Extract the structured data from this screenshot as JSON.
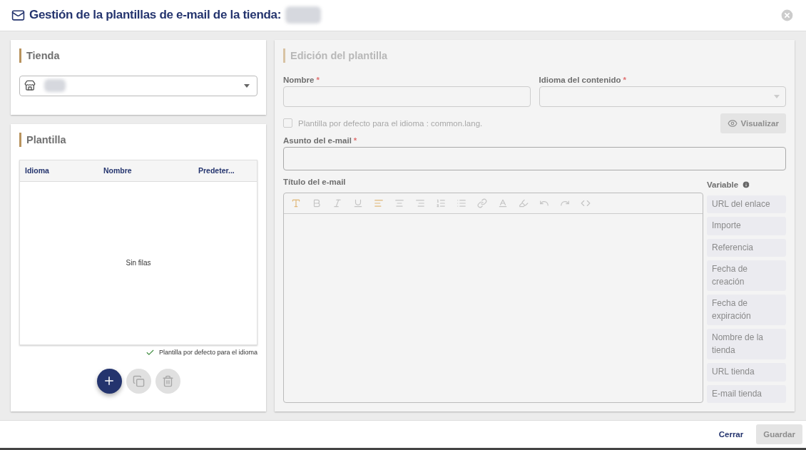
{
  "window": {
    "title": "Gestión de la plantillas de e-mail de la tienda:"
  },
  "store_card": {
    "title": "Tienda"
  },
  "template_card": {
    "title": "Plantilla",
    "table": {
      "columns": [
        "Idioma",
        "Nombre",
        "Predeter..."
      ],
      "empty_text": "Sin filas"
    },
    "legend": "Plantilla por defecto para el idioma",
    "actions": [
      {
        "kind": "add",
        "disabled": false
      },
      {
        "kind": "copy",
        "disabled": true
      },
      {
        "kind": "delete",
        "disabled": true
      }
    ]
  },
  "editor": {
    "title": "Edición del plantilla",
    "disabled": true,
    "name_label": "Nombre",
    "name_required_mark": "*",
    "language_label": "Idioma del contenido",
    "language_required_mark": "*",
    "default_checkbox": {
      "label": "Plantilla por defecto para el idioma : common.lang.",
      "checked": false
    },
    "preview_button": {
      "label": "Visualizar",
      "disabled": true
    },
    "subject_label": "Asunto del e-mail",
    "subject_required_mark": "*",
    "body_label": "Título del e-mail",
    "toolbar": [
      {
        "kind": "type",
        "active": true
      },
      {
        "kind": "bold",
        "active": false
      },
      {
        "kind": "italic",
        "active": false
      },
      {
        "kind": "underline",
        "active": false
      },
      {
        "kind": "align-left",
        "active": true
      },
      {
        "kind": "align-center",
        "active": false
      },
      {
        "kind": "align-right",
        "active": false
      },
      {
        "kind": "list-ordered",
        "active": false
      },
      {
        "kind": "list",
        "active": false
      },
      {
        "kind": "link",
        "active": false
      },
      {
        "kind": "text-color",
        "active": false
      },
      {
        "kind": "highlight",
        "active": false
      },
      {
        "kind": "undo",
        "active": false
      },
      {
        "kind": "redo",
        "active": false
      },
      {
        "kind": "code",
        "active": false
      }
    ],
    "variables_label": "Variable",
    "variables": [
      "URL del enlace",
      "Importe",
      "Referencia",
      "Fecha de creación",
      "Fecha de expiración",
      "Nombre de la tienda",
      "URL tienda",
      "E-mail tienda"
    ]
  },
  "footer": {
    "buttons": [
      {
        "label": "Cerrar",
        "kind": "text",
        "disabled": false
      },
      {
        "label": "Guardar",
        "kind": "filled",
        "disabled": true
      }
    ]
  }
}
